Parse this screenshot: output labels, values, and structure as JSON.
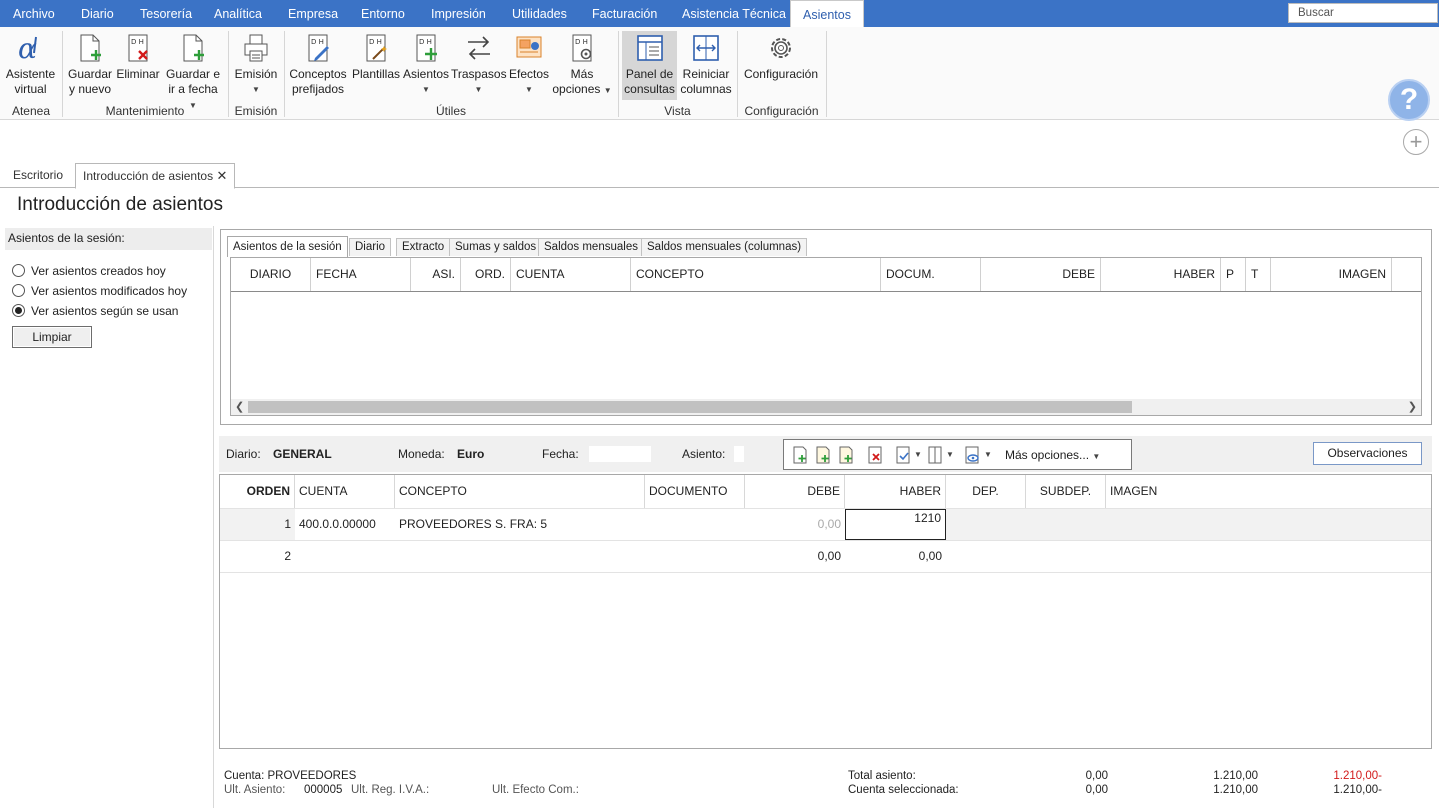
{
  "menu": {
    "items": [
      "Archivo",
      "Diario",
      "Tesorería",
      "Analítica",
      "Empresa",
      "Entorno",
      "Impresión",
      "Utilidades",
      "Facturación",
      "Asistencia Técnica",
      "Asientos"
    ],
    "search_placeholder": "Buscar"
  },
  "ribbon": {
    "buttons": {
      "asistente": [
        "Asistente",
        "virtual"
      ],
      "guardar_nuevo": [
        "Guardar",
        "y nuevo"
      ],
      "eliminar": [
        "Eliminar",
        ""
      ],
      "guardar_fecha": [
        "Guardar e",
        "ir a fecha"
      ],
      "emision": [
        "Emisión",
        ""
      ],
      "conceptos": [
        "Conceptos",
        "prefijados"
      ],
      "plantillas": [
        "Plantillas",
        ""
      ],
      "asientos": [
        "Asientos",
        ""
      ],
      "traspasos": [
        "Traspasos",
        ""
      ],
      "efectos": [
        "Efectos",
        ""
      ],
      "mas_opciones": [
        "Más",
        "opciones"
      ],
      "panel_consultas": [
        "Panel de",
        "consultas"
      ],
      "reiniciar_columnas": [
        "Reiniciar",
        "columnas"
      ],
      "configuracion": [
        "Configuración",
        ""
      ]
    },
    "groups": {
      "atenea": "Atenea",
      "mantenimiento": "Mantenimiento",
      "emision": "Emisión",
      "utiles": "Útiles",
      "vista": "Vista",
      "configuracion": "Configuración"
    }
  },
  "doc_tabs": {
    "escritorio": "Escritorio",
    "introduccion": "Introducción de asientos"
  },
  "page_title": "Introducción de asientos",
  "left_panel": {
    "header": "Asientos de la sesión:",
    "options": [
      "Ver asientos creados hoy",
      "Ver asientos modificados hoy",
      "Ver asientos según se usan"
    ],
    "selected_index": 2,
    "clear_button": "Limpiar"
  },
  "session": {
    "tabs": [
      "Asientos de la sesión",
      "Diario",
      "Extracto",
      "Sumas y saldos",
      "Saldos mensuales",
      "Saldos mensuales (columnas)"
    ],
    "columns": [
      "DIARIO",
      "FECHA",
      "ASI.",
      "ORD.",
      "CUENTA",
      "CONCEPTO",
      "DOCUM.",
      "DEBE",
      "HABER",
      "P",
      "T",
      "IMAGEN"
    ]
  },
  "entry": {
    "diario_label": "Diario:",
    "diario": "GENERAL",
    "moneda_label": "Moneda:",
    "moneda": "Euro",
    "fecha_label": "Fecha:",
    "asiento_label": "Asiento:",
    "more_options": "Más opciones...",
    "observaciones": "Observaciones",
    "columns": [
      "ORDEN",
      "CUENTA",
      "CONCEPTO",
      "DOCUMENTO",
      "DEBE",
      "HABER",
      "DEP.",
      "SUBDEP.",
      "IMAGEN"
    ],
    "rows": [
      {
        "orden": "1",
        "cuenta": "400.0.0.00000",
        "concepto": "PROVEEDORES S. FRA:  5",
        "documento": "",
        "debe": "0,00",
        "haber": "1210"
      },
      {
        "orden": "2",
        "cuenta": "",
        "concepto": "",
        "documento": "",
        "debe": "0,00",
        "haber": "0,00"
      }
    ]
  },
  "footer": {
    "cuenta_label": "Cuenta:",
    "cuenta": "PROVEEDORES",
    "ult_asiento_label": "Ult. Asiento:",
    "ult_asiento": "000005",
    "ult_reg_iva_label": "Ult. Reg. I.V.A.:",
    "ult_efecto_label": "Ult. Efecto Com.:",
    "total_asiento_label": "Total asiento:",
    "total_debe": "0,00",
    "total_haber": "1.210,00",
    "total_saldo": "1.210,00-",
    "cuenta_sel_label": "Cuenta seleccionada:",
    "sel_debe": "0,00",
    "sel_haber": "1.210,00",
    "sel_saldo": "1.210,00-"
  },
  "colors": {
    "menu_bg": "#3b73c6",
    "accent_green": "#2e9e3a",
    "accent_red": "#d21a1a",
    "negative": "#d21a1a"
  }
}
